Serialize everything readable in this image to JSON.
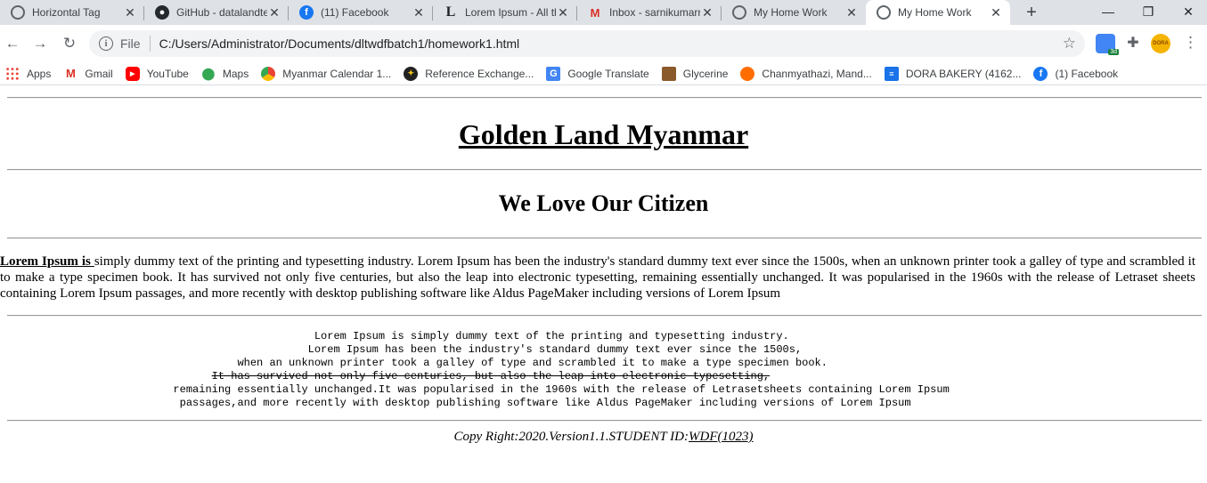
{
  "browser": {
    "tabs": [
      {
        "title": "Horizontal Tag",
        "favicon": "globe-icon",
        "active": false
      },
      {
        "title": "GitHub - datalandte",
        "favicon": "github-icon",
        "active": false
      },
      {
        "title": "(11) Facebook",
        "favicon": "facebook-icon",
        "active": false
      },
      {
        "title": "Lorem Ipsum - All th",
        "favicon": "lorem-L-icon",
        "active": false
      },
      {
        "title": "Inbox - sarnikumarr",
        "favicon": "gmail-icon",
        "active": false
      },
      {
        "title": "My Home Work",
        "favicon": "globe-icon",
        "active": false
      },
      {
        "title": "My Home Work",
        "favicon": "globe-icon",
        "active": true
      }
    ],
    "tab_close_glyph": "✕",
    "new_tab_glyph": "+",
    "window_controls": {
      "minimize": "—",
      "restore": "❐",
      "close": "✕"
    },
    "nav": {
      "back": "←",
      "forward": "→",
      "reload": "↻"
    },
    "omnibox": {
      "scheme_label": "File",
      "url": "C:/Users/Administrator/Documents/dltwdfbatch1/homework1.html",
      "star_glyph": "☆"
    },
    "extensions": {
      "meet_badge": "3d",
      "dora_label": "DORA"
    },
    "menu_glyph": "⋮",
    "bookmarks": [
      {
        "label": "Apps",
        "icon": "apps-grid-icon"
      },
      {
        "label": "Gmail",
        "icon": "gmail-icon"
      },
      {
        "label": "YouTube",
        "icon": "youtube-icon"
      },
      {
        "label": "Maps",
        "icon": "maps-pin-icon"
      },
      {
        "label": "Myanmar Calendar 1...",
        "icon": "myanmar-calendar-icon"
      },
      {
        "label": "Reference Exchange...",
        "icon": "reference-exchange-icon"
      },
      {
        "label": "Google Translate",
        "icon": "google-translate-icon"
      },
      {
        "label": "Glycerine",
        "icon": "glycerine-icon"
      },
      {
        "label": "Chanmyathazi, Mand...",
        "icon": "chanmyathazi-icon"
      },
      {
        "label": "DORA BAKERY (4162...",
        "icon": "docs-icon"
      },
      {
        "label": "(1) Facebook",
        "icon": "facebook-icon"
      }
    ]
  },
  "page": {
    "heading1": "Golden Land Myanmar",
    "heading2": "We Love Our Citizen",
    "paragraph": {
      "lead": "Lorem Ipsum is ",
      "text": "simply dummy text of the printing and typesetting industry. Lorem Ipsum has been the industry's standard dummy text ever since the 1500s, when an unknown printer took a galley of type and scrambled it to make a type specimen book. It has survived not only five centuries, but also the leap into electronic typesetting, remaining essentially unchanged. It was popularised in the 1960s with the release of Letraset sheets containing Lorem Ipsum passages, and more recently with desktop publishing software like Aldus PageMaker including versions of Lorem Ipsum"
    },
    "preformatted": [
      {
        "text": "                                                 Lorem Ipsum is simply dummy text of the printing and typesetting industry.",
        "strike": false
      },
      {
        "text": "                                                Lorem Ipsum has been the industry's standard dummy text ever since the 1500s,",
        "strike": false
      },
      {
        "text": "                                     when an unknown printer took a galley of type and scrambled it to make a type specimen book.",
        "strike": false
      },
      {
        "text": "It has survived not only five centuries, but also the leap into electronic typesetting,",
        "strike": true,
        "indent": "                                 "
      },
      {
        "text": "                           remaining essentially unchanged.It was popularised in the 1960s with the release of Letrasetsheets containing Lorem Ipsum",
        "strike": false
      },
      {
        "text": "                            passages,and more recently with desktop publishing software like Aldus PageMaker including versions of Lorem Ipsum",
        "strike": false
      }
    ],
    "footer": {
      "text": "Copy Right:2020.Version1.1.STUDENT ID:",
      "id": "WDF(1023)"
    }
  }
}
